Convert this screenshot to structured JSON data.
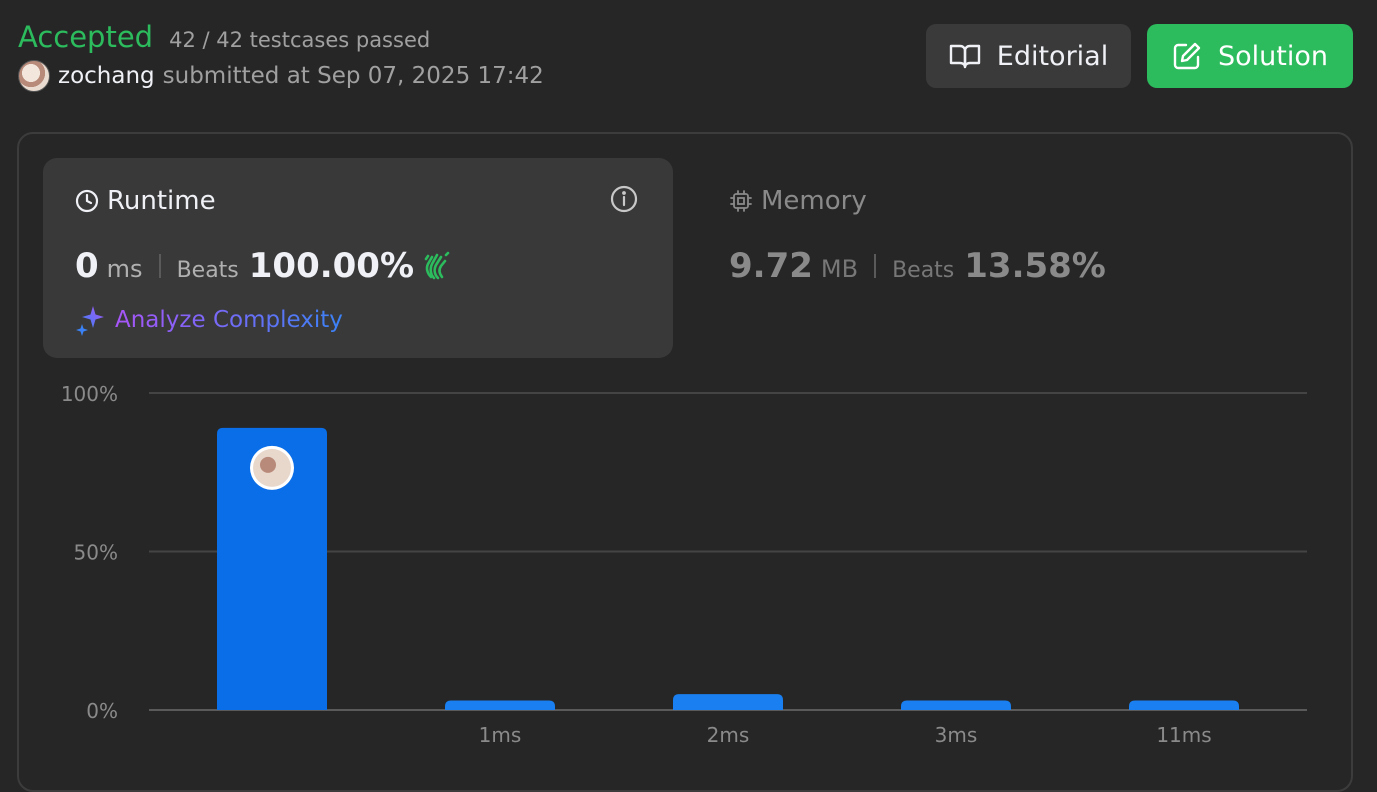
{
  "header": {
    "status": "Accepted",
    "testcases": "42 / 42 testcases passed",
    "username": "zochang",
    "submitted": "submitted at Sep 07, 2025 17:42"
  },
  "buttons": {
    "editorial": "Editorial",
    "solution": "Solution"
  },
  "runtime": {
    "title": "Runtime",
    "value": "0",
    "unit": "ms",
    "beats_label": "Beats",
    "beats_value": "100.00%",
    "analyze": "Analyze Complexity"
  },
  "memory": {
    "title": "Memory",
    "value": "9.72",
    "unit": "MB",
    "beats_label": "Beats",
    "beats_value": "13.58%"
  },
  "colors": {
    "accepted": "#2cbb5d",
    "bar": "#0a6ee8",
    "bar_light": "#1a7ff0"
  },
  "chart_data": {
    "type": "bar",
    "categories": [
      "",
      "1ms",
      "2ms",
      "3ms",
      "11ms"
    ],
    "values": [
      89,
      3,
      5,
      3,
      3
    ],
    "yticks": [
      "0%",
      "50%",
      "100%"
    ],
    "ylim": [
      0,
      100
    ],
    "grid": true,
    "user_marker_category": 0
  }
}
